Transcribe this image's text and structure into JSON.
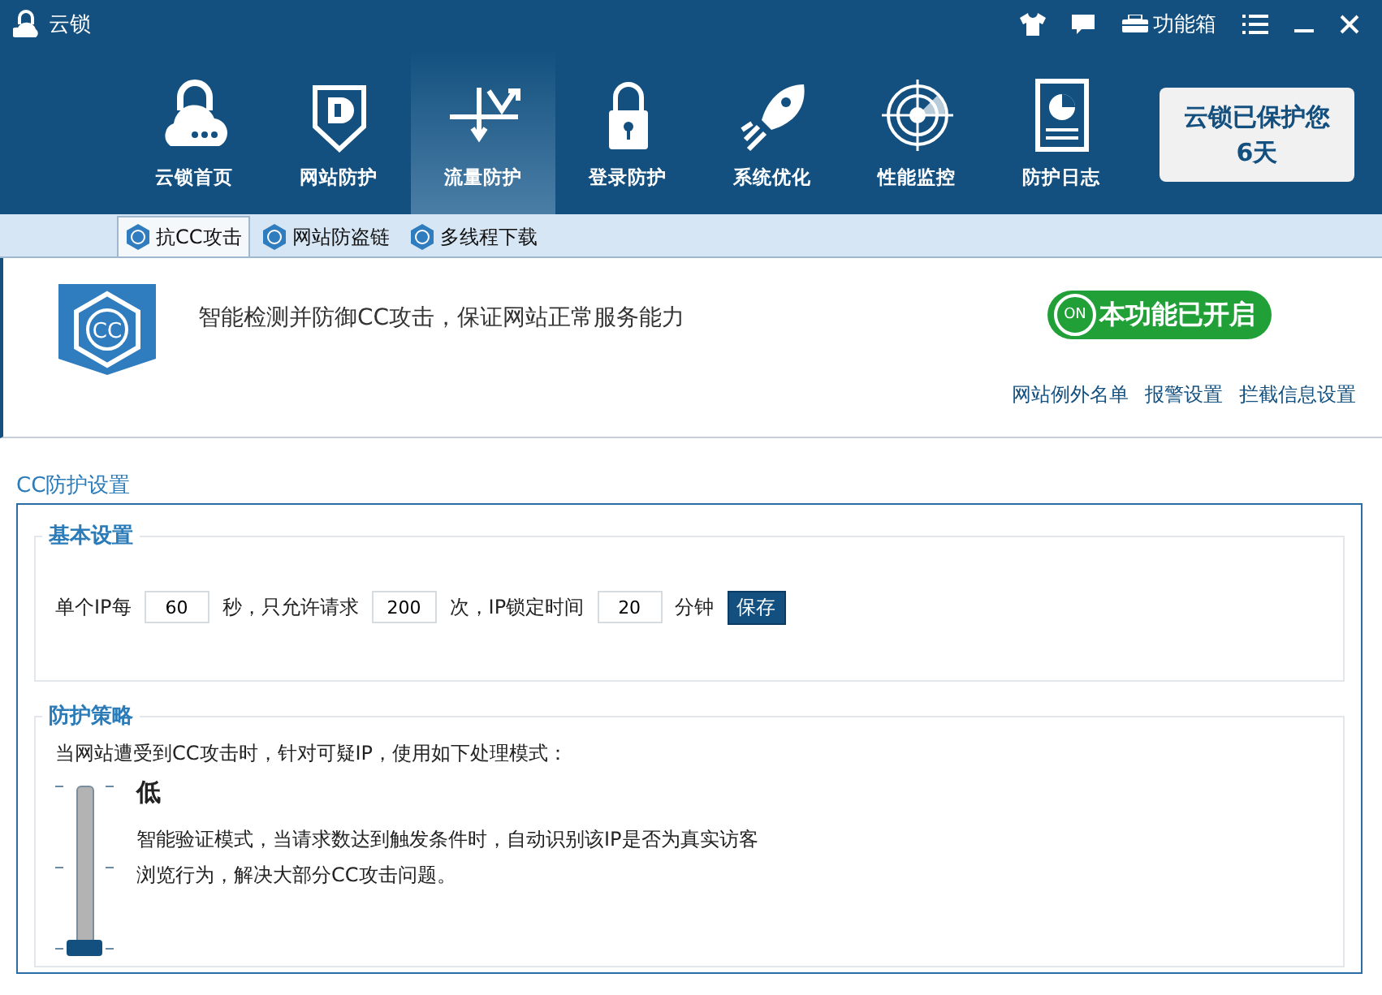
{
  "window": {
    "title": "云锁"
  },
  "title_bar": {
    "toolbox_label": "功能箱"
  },
  "nav": [
    {
      "label": "云锁首页",
      "selected": false
    },
    {
      "label": "网站防护",
      "selected": false
    },
    {
      "label": "流量防护",
      "selected": true
    },
    {
      "label": "登录防护",
      "selected": false
    },
    {
      "label": "系统优化",
      "selected": false
    },
    {
      "label": "性能监控",
      "selected": false
    },
    {
      "label": "防护日志",
      "selected": false
    }
  ],
  "protect_box": {
    "line1": "云锁已保护您",
    "line2": "6天"
  },
  "sub_tabs": [
    {
      "label": "抗CC攻击",
      "selected": true
    },
    {
      "label": "网站防盗链",
      "selected": false
    },
    {
      "label": "多线程下载",
      "selected": false
    }
  ],
  "feature": {
    "badge": "CC",
    "description": "智能检测并防御CC攻击，保证网站正常服务能力",
    "toggle_icon": "ON",
    "toggle_label": "本功能已开启",
    "on": true,
    "links": [
      "网站例外名单",
      "报警设置",
      "拦截信息设置"
    ]
  },
  "settings": {
    "title": "CC防护设置",
    "basic": {
      "title": "基本设置",
      "label_1": "单个IP每",
      "seconds": "60",
      "label_2": "秒，只允许请求",
      "requests": "200",
      "label_3": "次，IP锁定时间",
      "minutes": "20",
      "label_4": "分钟",
      "save": "保存"
    },
    "policy": {
      "title": "防护策略",
      "intro": "当网站遭受到CC攻击时，针对可疑IP，使用如下处理模式：",
      "level": 0,
      "mode_title": "低",
      "mode_description": "智能验证模式，当请求数达到触发条件时，自动识别该IP是否为真实访客浏览行为，解决大部分CC攻击问题。"
    }
  }
}
